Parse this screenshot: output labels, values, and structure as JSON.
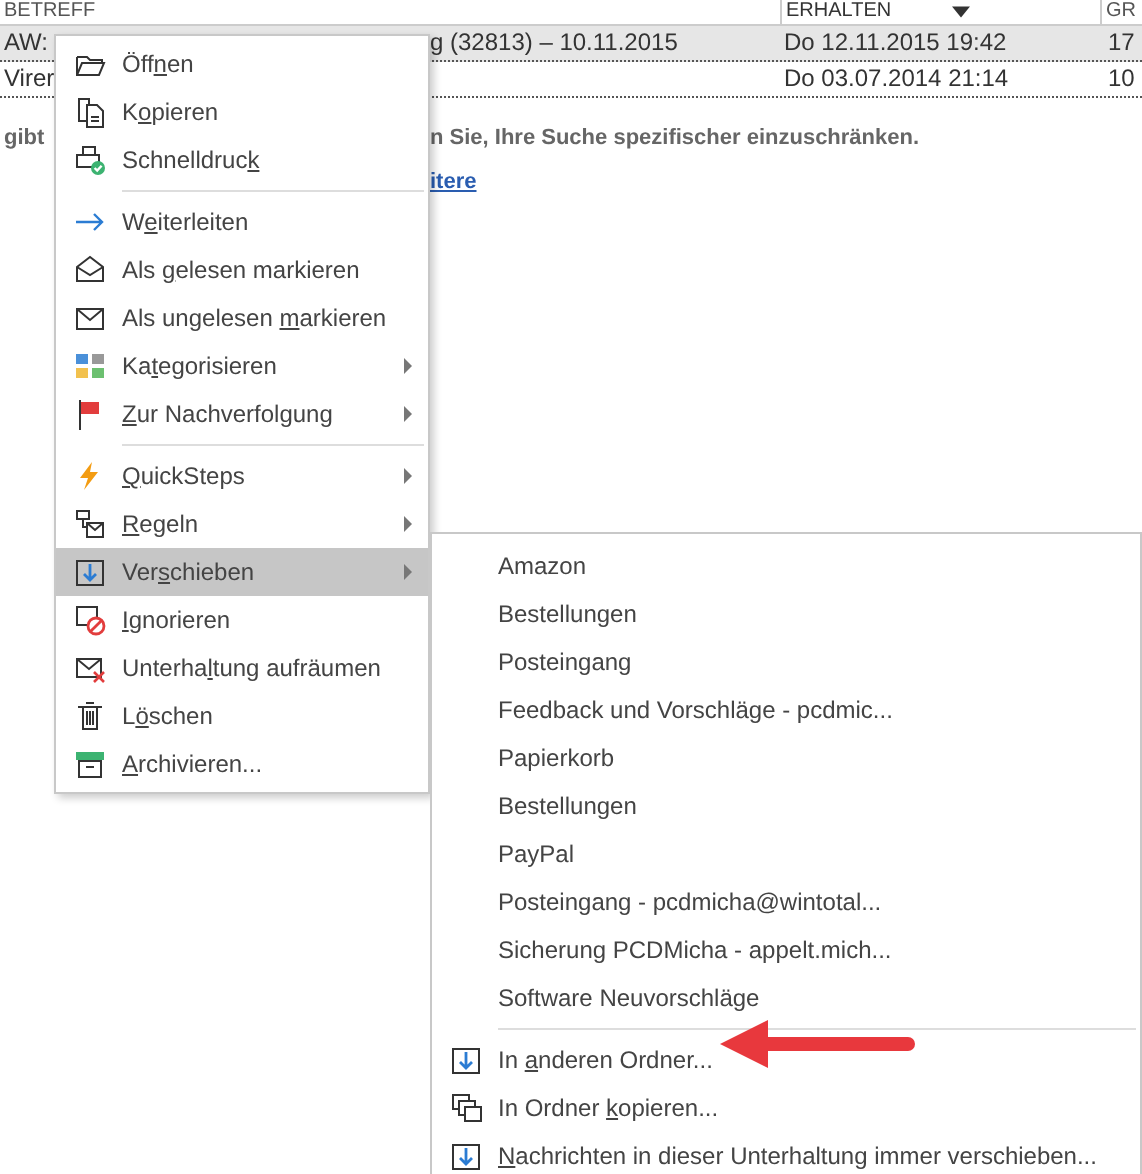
{
  "list_header": {
    "columns": [
      {
        "label": "BETREFF",
        "sorted": false
      },
      {
        "label": "ERHALTEN",
        "sorted": true
      },
      {
        "label": "GR",
        "sorted": false
      }
    ]
  },
  "rows": [
    {
      "subject_start": "AW:",
      "subject_end": "g (32813) – 10.11.2015",
      "received": "Do 12.11.2015 19:42",
      "size": "17",
      "selected": true
    },
    {
      "subject_start": "Virer",
      "received": "Do 03.07.2014 21:14",
      "size": "10",
      "selected": false
    }
  ],
  "notice": {
    "start": "gibt",
    "end": "n Sie, Ihre Suche spezifischer einzuschränken.",
    "link": "itere"
  },
  "context_menu": {
    "items": [
      {
        "kind": "item",
        "pre": "Öff",
        "key": "n",
        "post": "en",
        "submenu": false,
        "selected": false
      },
      {
        "kind": "item",
        "pre": "K",
        "key": "o",
        "post": "pieren",
        "submenu": false,
        "selected": false
      },
      {
        "kind": "item",
        "pre": "Schnelldruc",
        "key": "k",
        "submenu": false,
        "selected": false
      },
      {
        "kind": "separator"
      },
      {
        "kind": "item",
        "pre": "W",
        "key": "e",
        "post": "iterleiten",
        "submenu": false,
        "selected": false
      },
      {
        "kind": "item",
        "pre": "Als ",
        "key": "g",
        "post": "elesen markieren",
        "submenu": false,
        "selected": false
      },
      {
        "kind": "item",
        "pre": "Als ungelesen ",
        "key": "m",
        "post": "arkieren",
        "submenu": false,
        "selected": false
      },
      {
        "kind": "item",
        "pre": "Ka",
        "key": "t",
        "post": "egorisieren",
        "submenu": true,
        "selected": false
      },
      {
        "kind": "item",
        "key": "Z",
        "post": "ur Nachverfolgung",
        "submenu": true,
        "selected": false
      },
      {
        "kind": "separator"
      },
      {
        "kind": "item",
        "key": "Q",
        "post": "uickSteps",
        "submenu": true,
        "selected": false
      },
      {
        "kind": "item",
        "key": "R",
        "post": "egeln",
        "submenu": true,
        "selected": false
      },
      {
        "kind": "item",
        "pre": "Ver",
        "key": "s",
        "post": "chieben",
        "submenu": true,
        "selected": true
      },
      {
        "kind": "item",
        "key": "I",
        "post": "gnorieren",
        "submenu": false,
        "selected": false
      },
      {
        "kind": "item",
        "pre": "Unterha",
        "key": "l",
        "post": "tung aufräumen",
        "submenu": false,
        "selected": false
      },
      {
        "kind": "item",
        "pre": "L",
        "key": "ö",
        "post": "schen",
        "submenu": false,
        "selected": false
      },
      {
        "kind": "item",
        "key": "A",
        "post": "rchivieren...",
        "submenu": false,
        "selected": false
      }
    ]
  },
  "move_submenu": {
    "items": [
      {
        "kind": "folder",
        "pre": "Amazon"
      },
      {
        "kind": "folder",
        "pre": "Bestellungen"
      },
      {
        "kind": "folder",
        "pre": "Posteingang"
      },
      {
        "kind": "folder",
        "pre": "Feedback und Vorschläge - pcdmic..."
      },
      {
        "kind": "folder",
        "pre": "Papierkorb"
      },
      {
        "kind": "folder",
        "pre": "Bestellungen"
      },
      {
        "kind": "folder",
        "pre": "PayPal"
      },
      {
        "kind": "folder",
        "pre": "Posteingang - pcdmicha@wintotal..."
      },
      {
        "kind": "folder",
        "pre": "Sicherung PCDMicha - appelt.mich..."
      },
      {
        "kind": "folder",
        "pre": "Software Neuvorschläge"
      },
      {
        "kind": "separator"
      },
      {
        "kind": "move",
        "pre": "In ",
        "key": "a",
        "post": "nderen Ordner..."
      },
      {
        "kind": "copy",
        "pre": "In Ordner ",
        "key": "k",
        "post": "opieren..."
      },
      {
        "kind": "move",
        "key": "N",
        "post": "achrichten in dieser Unterhaltung immer verschieben..."
      }
    ]
  }
}
